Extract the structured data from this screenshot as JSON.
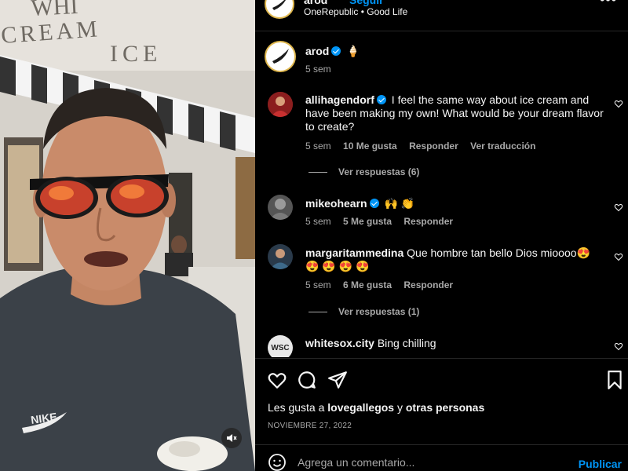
{
  "post": {
    "author": "arod",
    "follow_label": "Seguir",
    "audio": "OneRepublic • Good Life",
    "more_label": "•••"
  },
  "caption": {
    "username": "arod",
    "text": "🍦",
    "time": "5 sem"
  },
  "comments": [
    {
      "username": "allihagendorf",
      "text": "I feel the same way about ice cream and have been making my own! What would be your dream flavor to create?",
      "time": "5 sem",
      "likes": "10 Me gusta",
      "reply_label": "Responder",
      "translate_label": "Ver traducción",
      "view_replies": "Ver respuestas (6)"
    },
    {
      "username": "mikeohearn",
      "text": "🙌 👏",
      "time": "5 sem",
      "likes": "5 Me gusta",
      "reply_label": "Responder"
    },
    {
      "username": "margaritammedina",
      "text": "Que hombre tan bello Dios mioooo😍 😍 😍 😍 😍",
      "time": "5 sem",
      "likes": "6 Me gusta",
      "reply_label": "Responder",
      "view_replies": "Ver respuestas (1)"
    },
    {
      "username": "whitesox.city",
      "text": "Bing chilling",
      "avatar_text": "WSC"
    }
  ],
  "likes_summary": {
    "prefix": "Les gusta a",
    "user": "lovegallegos",
    "connector": "y",
    "others": "otras personas"
  },
  "date": "NOVIEMBRE 27, 2022",
  "add_comment": {
    "placeholder": "Agrega un comentario...",
    "publish_label": "Publicar"
  },
  "media": {
    "sign_text_top": "WHI",
    "sign_text_mid": "CREAM",
    "sign_text_ice": "ICE",
    "shirt_logo": "NIKE"
  },
  "colors": {
    "accent_blue": "#0095f6",
    "background": "#000000",
    "secondary_text": "#a8a8a8"
  }
}
